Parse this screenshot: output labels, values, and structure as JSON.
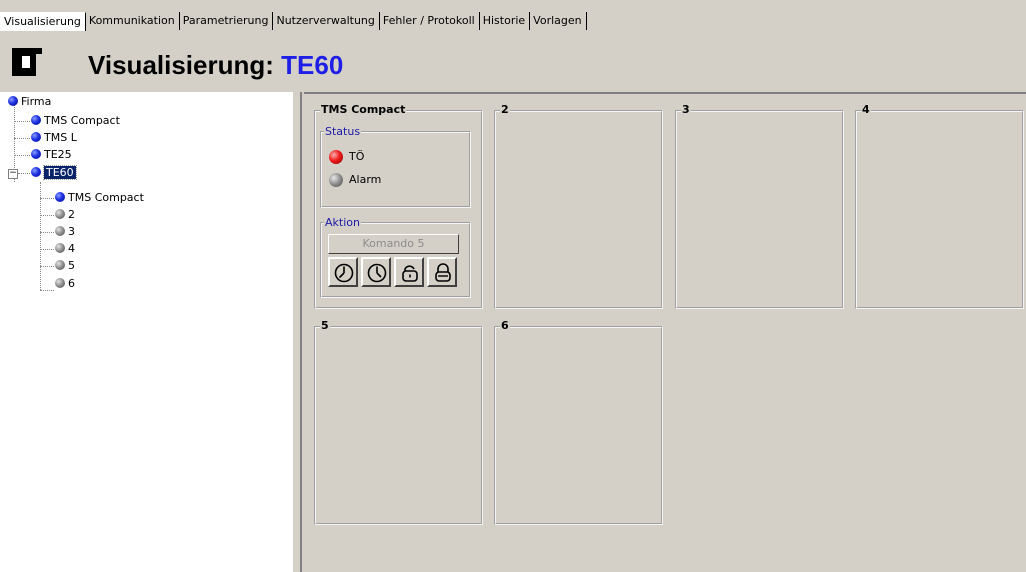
{
  "tabs": [
    {
      "label": "Visualisierung"
    },
    {
      "label": "Kommunikation"
    },
    {
      "label": "Parametrierung"
    },
    {
      "label": "Nutzerverwaltung"
    },
    {
      "label": "Fehler / Protokoll"
    },
    {
      "label": "Historie"
    },
    {
      "label": "Vorlagen"
    }
  ],
  "header": {
    "title_prefix": "Visualisierung: ",
    "title_value": "TE60"
  },
  "tree": {
    "root": "Firma",
    "items": [
      "TMS Compact",
      "TMS L",
      "TE25",
      "TE60"
    ],
    "children": [
      "TMS Compact",
      "2",
      "3",
      "4",
      "5",
      "6"
    ],
    "root_icon": "blue-dot-icon",
    "online_icon": "blue-dot-icon",
    "offline_icon": "gray-dot-icon"
  },
  "panels": {
    "p1": {
      "title": "TMS Compact",
      "status": {
        "title": "Status",
        "items": [
          {
            "label": "TÖ",
            "color": "#ee1a1a"
          },
          {
            "label": "Alarm",
            "color": "#8c8c8c"
          }
        ]
      },
      "action": {
        "title": "Aktion",
        "command_label": "Komando 5",
        "icons": [
          "clock-start-icon",
          "clock-icon",
          "unlock-icon",
          "lock-icon"
        ]
      }
    },
    "p2": {
      "title": "2"
    },
    "p3": {
      "title": "3"
    },
    "p4": {
      "title": "4"
    },
    "p5": {
      "title": "5"
    },
    "p6": {
      "title": "6"
    }
  },
  "colors": {
    "accent": "#1e1ee6",
    "selection": "#0a246a",
    "panel_bg": "#d4d0c8"
  }
}
